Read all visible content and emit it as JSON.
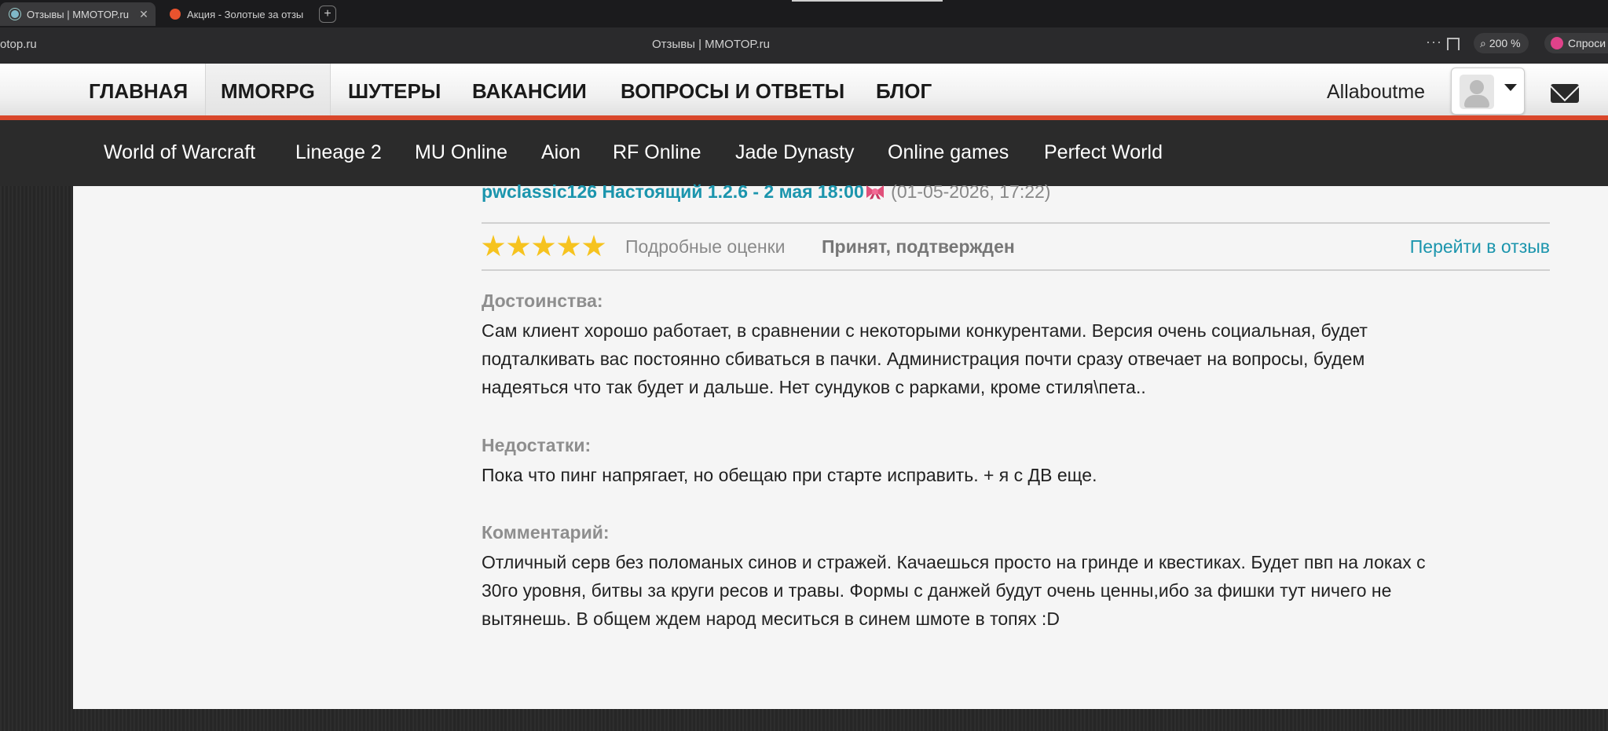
{
  "browser": {
    "tabs": [
      {
        "title": "Отзывы | MMOTOP.ru",
        "active": true
      },
      {
        "title": "Акция - Золотые за отзы",
        "active": false
      }
    ],
    "new_tab": "+",
    "url": "otop.ru",
    "page_title": "Отзывы | MMOTOP.ru",
    "zoom": "200 %",
    "ask_label": "Спроси"
  },
  "site": {
    "main_nav": [
      "ГЛАВНАЯ",
      "MMORPG",
      "ШУТЕРЫ",
      "ВАКАНСИИ",
      "ВОПРОСЫ И ОТВЕТЫ",
      "БЛОГ"
    ],
    "active_nav": "MMORPG",
    "username": "Allaboutme",
    "sub_nav": [
      "World of Warcraft",
      "Lineage 2",
      "MU Online",
      "Aion",
      "RF Online",
      "Jade Dynasty",
      "Online games",
      "Perfect World"
    ],
    "accent_color": "#d9472b",
    "link_color": "#1b95ad"
  },
  "review": {
    "title": "pwclassic126 Настоящий 1.2.6 - 2 мая 18:00",
    "date": "(01-05-2026, 17:22)",
    "rating": 5,
    "rating_max": 5,
    "detailed_ratings": "Подробные оценки",
    "status": "Принят, подтвержден",
    "goto_label": "Перейти в отзыв",
    "pros_label": "Достоинства:",
    "pros_lines": [
      "Сам клиент хорошо работает, в сравнении с некоторыми конкурентами. Версия очень социальная, будет",
      "подталкивать вас постоянно сбиваться в пачки. Администрация почти сразу отвечает на вопросы, будем",
      "надеяться что так будет и дальше. Нет сундуков с рарками, кроме стиля\\пета.."
    ],
    "cons_label": "Недостатки:",
    "cons_lines": [
      "Пока что пинг напрягает, но обещаю при старте исправить. + я с ДВ еще."
    ],
    "comment_label": "Комментарий:",
    "comment_lines": [
      "Отличный серв без поломаных синов и стражей. Качаешься просто на гринде и квестиках. Будет пвп на локах с",
      "30го уровня, битвы за круги ресов и травы. Формы с данжей будут очень ценны,ибо за фишки тут ничего не",
      "вытянешь. В общем ждем народ меситься в синем шмоте в топях :D"
    ]
  }
}
